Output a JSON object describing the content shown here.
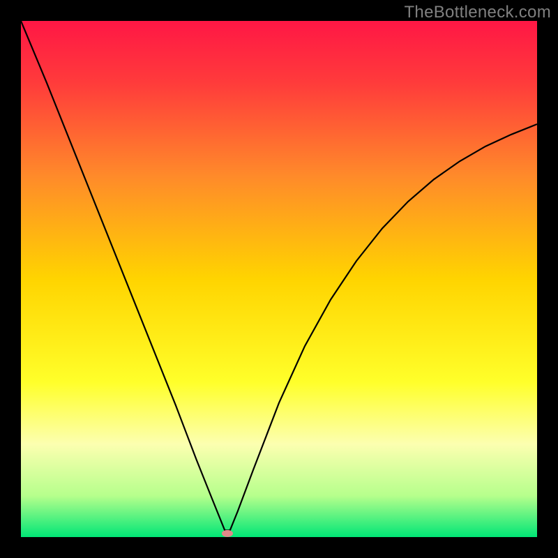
{
  "watermark": "TheBottleneck.com",
  "chart_data": {
    "type": "line",
    "title": "",
    "xlabel": "",
    "ylabel": "",
    "xlim": [
      0,
      100
    ],
    "ylim": [
      0,
      100
    ],
    "background_gradient": {
      "stops": [
        {
          "pct": 0,
          "color": "#ff1745"
        },
        {
          "pct": 12,
          "color": "#ff3b3b"
        },
        {
          "pct": 30,
          "color": "#ff8a2a"
        },
        {
          "pct": 50,
          "color": "#ffd400"
        },
        {
          "pct": 70,
          "color": "#ffff2a"
        },
        {
          "pct": 82,
          "color": "#fcffb0"
        },
        {
          "pct": 92,
          "color": "#b6ff8c"
        },
        {
          "pct": 100,
          "color": "#00e676"
        }
      ]
    },
    "series": [
      {
        "name": "bottleneck-curve",
        "color": "#000000",
        "x": [
          0,
          5,
          10,
          15,
          20,
          25,
          30,
          34,
          37,
          39.5,
          40.5,
          42,
          45,
          50,
          55,
          60,
          65,
          70,
          75,
          80,
          85,
          90,
          95,
          100
        ],
        "y": [
          100,
          88,
          75.5,
          63,
          50.5,
          38,
          25.5,
          15,
          7.5,
          1.3,
          1.3,
          5,
          13,
          26,
          37,
          46,
          53.5,
          59.8,
          65,
          69.3,
          72.8,
          75.7,
          78,
          80
        ]
      }
    ],
    "marker": {
      "x": 40,
      "y": 0.7,
      "color": "#e08a8a",
      "rx": 8,
      "ry": 5
    }
  }
}
